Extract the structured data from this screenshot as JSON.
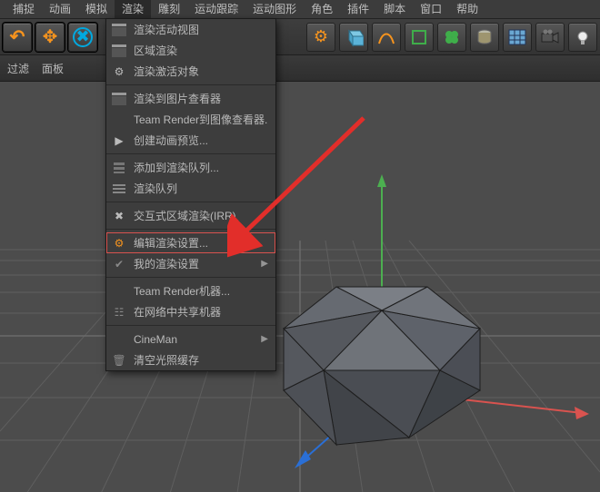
{
  "menubar": {
    "items": [
      "捕捉",
      "动画",
      "模拟",
      "渲染",
      "雕刻",
      "运动跟踪",
      "运动图形",
      "角色",
      "插件",
      "脚本",
      "窗口",
      "帮助"
    ],
    "active_index": 3
  },
  "toolbar": {
    "undo": "↶",
    "move": "✥",
    "cancel": "✖",
    "render": "🎬",
    "render_settings": "⚙",
    "cube": "■",
    "sphere": "●",
    "group": "▣",
    "clover": "✿",
    "tube": "◑",
    "grid": "▦",
    "camera": "🎥",
    "light": "●"
  },
  "tabs": {
    "filter": "过滤",
    "panel": "面板"
  },
  "menu": {
    "items": [
      {
        "icon": "clapper",
        "label": "渲染活动视图"
      },
      {
        "icon": "clapper",
        "label": "区域渲染"
      },
      {
        "icon": "gear",
        "label": "渲染激活对象"
      },
      {
        "sep": true
      },
      {
        "icon": "clapper",
        "label": "渲染到图片查看器"
      },
      {
        "icon": "none",
        "label": "Team Render到图像查看器..."
      },
      {
        "icon": "play",
        "label": "创建动画预览..."
      },
      {
        "sep": true
      },
      {
        "icon": "queue",
        "label": "添加到渲染队列..."
      },
      {
        "icon": "list",
        "label": "渲染队列"
      },
      {
        "sep": true
      },
      {
        "icon": "cross",
        "label": "交互式区域渲染(IRR)"
      },
      {
        "sep": true
      },
      {
        "icon": "gear-orange",
        "label": "编辑渲染设置...",
        "highlight": true
      },
      {
        "icon": "check",
        "label": "我的渲染设置",
        "submenu": true
      },
      {
        "sep": true
      },
      {
        "icon": "none",
        "label": "Team Render机器..."
      },
      {
        "icon": "net",
        "label": "在网络中共享机器"
      },
      {
        "sep": true
      },
      {
        "icon": "none",
        "label": "CineMan",
        "submenu": true
      },
      {
        "icon": "trash",
        "label": "清空光照缓存"
      }
    ]
  },
  "colors": {
    "accent_orange": "#f7941e",
    "accent_blue": "#00a9e0",
    "accent_green": "#4CAF50",
    "arrow_red": "#e22e2a"
  }
}
